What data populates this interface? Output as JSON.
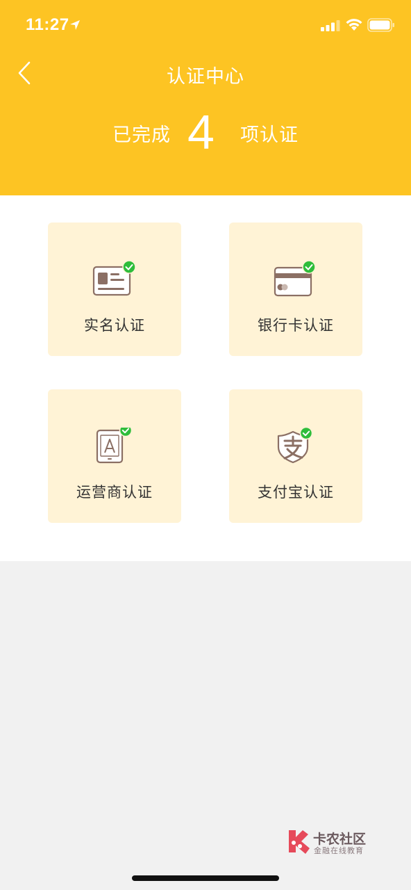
{
  "status_bar": {
    "time": "11:27",
    "icons": [
      "location-arrow-icon",
      "signal-icon",
      "wifi-icon",
      "battery-icon"
    ]
  },
  "header": {
    "title": "认证中心",
    "back_icon": "chevron-left-icon",
    "summary_prefix": "已完成",
    "summary_count": "4",
    "summary_suffix": "项认证",
    "background_color": "#fdc423"
  },
  "cards": [
    {
      "label": "实名认证",
      "icon": "id-card-icon",
      "verified": true
    },
    {
      "label": "银行卡认证",
      "icon": "bank-card-icon",
      "verified": true
    },
    {
      "label": "运营商认证",
      "icon": "carrier-phone-icon",
      "verified": true
    },
    {
      "label": "支付宝认证",
      "icon": "alipay-shield-icon",
      "verified": true
    }
  ],
  "colors": {
    "accent": "#fdc423",
    "card_bg": "#fff3d6",
    "icon_brown": "#8b6f64",
    "check_green": "#2ebd3b"
  },
  "watermark": {
    "title": "卡农社区",
    "subtitle": "金融在线教育"
  }
}
